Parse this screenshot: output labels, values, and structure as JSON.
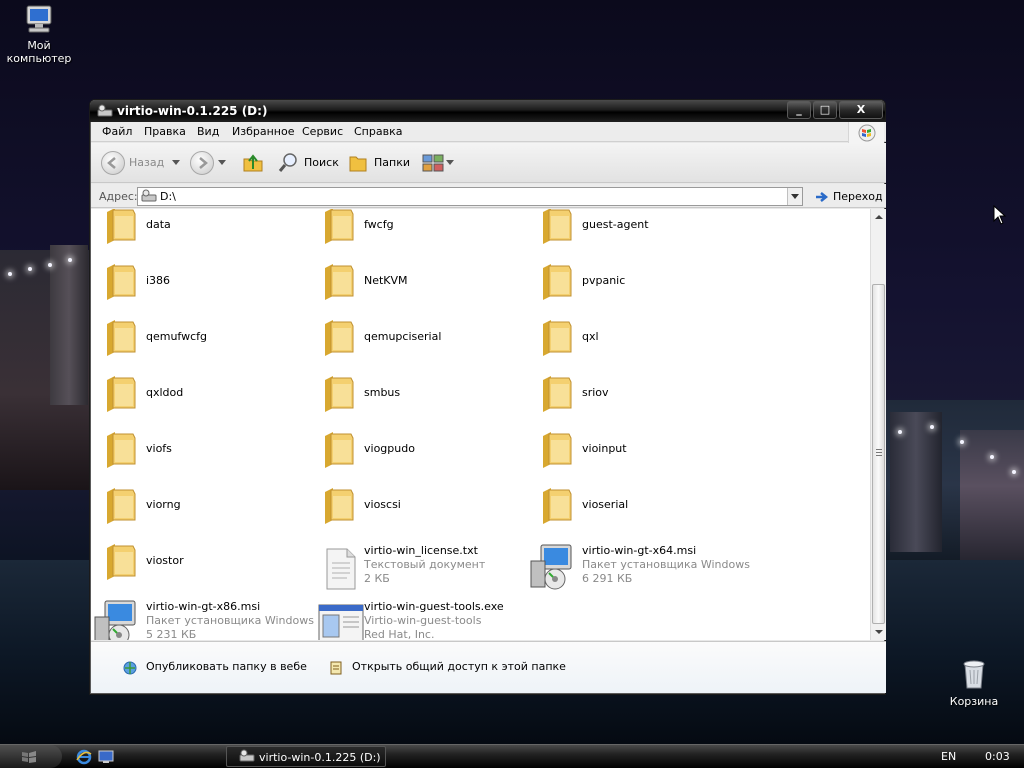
{
  "desktop": {
    "icons": [
      {
        "label_line1": "Мой",
        "label_line2": "компьютер",
        "icon": "my-computer-icon"
      },
      {
        "label": "Корзина",
        "icon": "recycle-bin-icon"
      }
    ]
  },
  "window": {
    "title": "virtio-win-0.1.225 (D:)",
    "buttons": {
      "minimize": "_",
      "maximize": "□",
      "close": "X"
    }
  },
  "menu": [
    "Файл",
    "Правка",
    "Вид",
    "Избранное",
    "Сервис",
    "Справка"
  ],
  "toolbar": {
    "back_label": "Назад",
    "search_label": "Поиск",
    "folders_label": "Папки"
  },
  "address": {
    "label": "Адрес:",
    "value": "D:\\",
    "go_label": "Переход"
  },
  "items": [
    {
      "name": "data",
      "type": "folder"
    },
    {
      "name": "fwcfg",
      "type": "folder"
    },
    {
      "name": "guest-agent",
      "type": "folder"
    },
    {
      "name": "i386",
      "type": "folder"
    },
    {
      "name": "NetKVM",
      "type": "folder"
    },
    {
      "name": "pvpanic",
      "type": "folder"
    },
    {
      "name": "qemufwcfg",
      "type": "folder"
    },
    {
      "name": "qemupciserial",
      "type": "folder"
    },
    {
      "name": "qxl",
      "type": "folder"
    },
    {
      "name": "qxldod",
      "type": "folder"
    },
    {
      "name": "smbus",
      "type": "folder"
    },
    {
      "name": "sriov",
      "type": "folder"
    },
    {
      "name": "viofs",
      "type": "folder"
    },
    {
      "name": "viogpudo",
      "type": "folder"
    },
    {
      "name": "vioinput",
      "type": "folder"
    },
    {
      "name": "viorng",
      "type": "folder"
    },
    {
      "name": "vioscsi",
      "type": "folder"
    },
    {
      "name": "vioserial",
      "type": "folder"
    },
    {
      "name": "viostor",
      "type": "folder"
    },
    {
      "name": "virtio-win_license.txt",
      "type": "text",
      "line2": "Текстовый документ",
      "line3": "2 КБ"
    },
    {
      "name": "virtio-win-gt-x64.msi",
      "type": "msi",
      "line2": "Пакет установщика Windows",
      "line3": "6 291 КБ"
    },
    {
      "name": "virtio-win-gt-x86.msi",
      "type": "msi",
      "line2": "Пакет установщика Windows",
      "line3": "5 231 КБ"
    },
    {
      "name": "virtio-win-guest-tools.exe",
      "type": "exe",
      "line2": "Virtio-win-guest-tools",
      "line3": "Red Hat, Inc."
    }
  ],
  "tasks": {
    "publish": "Опубликовать папку в вебе",
    "share": "Открыть общий доступ к этой папке"
  },
  "taskbar": {
    "task_label": "virtio-win-0.1.225 (D:)",
    "language": "EN",
    "clock": "0:03"
  }
}
